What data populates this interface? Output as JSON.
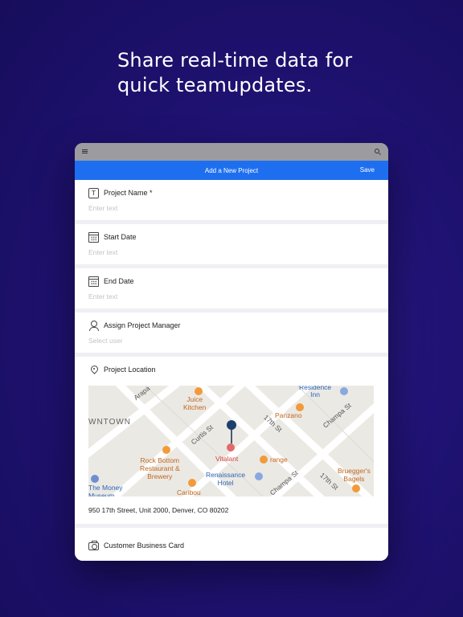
{
  "headline": "Share real-time data for quick teamupdates.",
  "nav": {
    "title": "Add a New Project",
    "save_label": "Save"
  },
  "form": {
    "project_name": {
      "label": "Project Name *",
      "placeholder": "Enter text"
    },
    "start_date": {
      "label": "Start Date",
      "placeholder": "Enter text"
    },
    "end_date": {
      "label": "End Date",
      "placeholder": "Enter text"
    },
    "manager": {
      "label": "Assign Project Manager",
      "placeholder": "Select user"
    },
    "location": {
      "label": "Project Location",
      "address": "950 17th Street, Unit 2000, Denver, CO 80202"
    },
    "business_card": {
      "label": "Customer Business Card"
    }
  },
  "map": {
    "district": "WNTOWN",
    "pois": {
      "residence": "Residence\nInn",
      "juice": "Juice\nKitchen",
      "panzano": "Panzano",
      "vitalant": "Vitalant",
      "range": "range",
      "rockbottom": "Rock Bottom\nRestaurant &\nBrewery",
      "renaissance": "Renaissance\nHotel",
      "caribou": "Caribou",
      "brueggers": "Bruegger's\nBagels",
      "money": "The Money\nMuseum"
    },
    "streets": {
      "arapahoe": "Arapa",
      "curtis": "Curtis St",
      "s17th_a": "17th St",
      "champa_a": "Champa St",
      "champa_b": "Champa St",
      "s17th_b": "17th St"
    }
  },
  "colors": {
    "primary": "#1e6ff0",
    "background": "#1f1273",
    "pin": "#1d3f6e"
  }
}
